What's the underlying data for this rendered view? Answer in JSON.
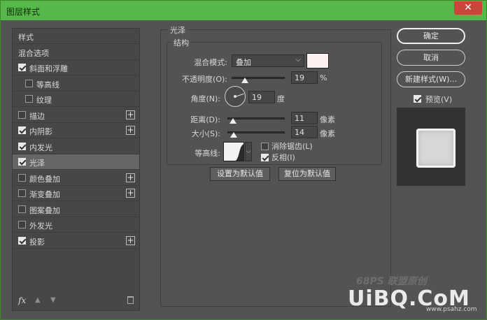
{
  "window": {
    "title": "图层样式",
    "close": "✕"
  },
  "left_panel": {
    "items": [
      {
        "label": "样式",
        "has_checkbox": false,
        "checked": false,
        "has_plus": false,
        "selected": false,
        "indent": false
      },
      {
        "label": "混合选项",
        "has_checkbox": false,
        "checked": false,
        "has_plus": false,
        "selected": false,
        "indent": false
      },
      {
        "label": "斜面和浮雕",
        "has_checkbox": true,
        "checked": true,
        "has_plus": false,
        "selected": false,
        "indent": false
      },
      {
        "label": "等高线",
        "has_checkbox": true,
        "checked": false,
        "has_plus": false,
        "selected": false,
        "indent": true
      },
      {
        "label": "纹理",
        "has_checkbox": true,
        "checked": false,
        "has_plus": false,
        "selected": false,
        "indent": true
      },
      {
        "label": "描边",
        "has_checkbox": true,
        "checked": false,
        "has_plus": true,
        "selected": false,
        "indent": false
      },
      {
        "label": "内阴影",
        "has_checkbox": true,
        "checked": true,
        "has_plus": true,
        "selected": false,
        "indent": false
      },
      {
        "label": "内发光",
        "has_checkbox": true,
        "checked": true,
        "has_plus": false,
        "selected": false,
        "indent": false
      },
      {
        "label": "光泽",
        "has_checkbox": true,
        "checked": true,
        "has_plus": false,
        "selected": true,
        "indent": false
      },
      {
        "label": "颜色叠加",
        "has_checkbox": true,
        "checked": false,
        "has_plus": true,
        "selected": false,
        "indent": false
      },
      {
        "label": "渐变叠加",
        "has_checkbox": true,
        "checked": false,
        "has_plus": true,
        "selected": false,
        "indent": false
      },
      {
        "label": "图案叠加",
        "has_checkbox": true,
        "checked": false,
        "has_plus": false,
        "selected": false,
        "indent": false
      },
      {
        "label": "外发光",
        "has_checkbox": true,
        "checked": false,
        "has_plus": false,
        "selected": false,
        "indent": false
      },
      {
        "label": "投影",
        "has_checkbox": true,
        "checked": true,
        "has_plus": true,
        "selected": false,
        "indent": false
      }
    ],
    "footer": {
      "fx": "fx",
      "up": "▲",
      "down": "▼"
    }
  },
  "satin": {
    "section_title": "光泽",
    "structure_title": "结构",
    "blend_mode": {
      "label": "混合模式:",
      "value": "叠加",
      "color": "#fdf0f0"
    },
    "opacity": {
      "label": "不透明度(O):",
      "value": "19",
      "unit": "%",
      "slider_fraction": 0.19
    },
    "angle": {
      "label": "角度(N):",
      "value": "19",
      "unit": "度"
    },
    "distance": {
      "label": "距离(D):",
      "value": "11",
      "unit": "像素",
      "slider_fraction": 0.04
    },
    "size": {
      "label": "大小(S):",
      "value": "14",
      "unit": "像素",
      "slider_fraction": 0.05
    },
    "contour": {
      "label": "等高线:"
    },
    "anti_alias": {
      "label": "消除锯齿(L)",
      "checked": false
    },
    "invert": {
      "label": "反相(I)",
      "checked": true
    },
    "make_default": "设置为默认值",
    "reset_default": "复位为默认值"
  },
  "right_panel": {
    "ok": "确定",
    "cancel": "取消",
    "new_style": "新建样式(W)...",
    "preview": {
      "label": "预览(V)",
      "checked": true
    }
  },
  "watermark": {
    "top": "68PS 联盟原创",
    "brand": "UiBQ.CoM",
    "url": "www.psahz.com"
  }
}
